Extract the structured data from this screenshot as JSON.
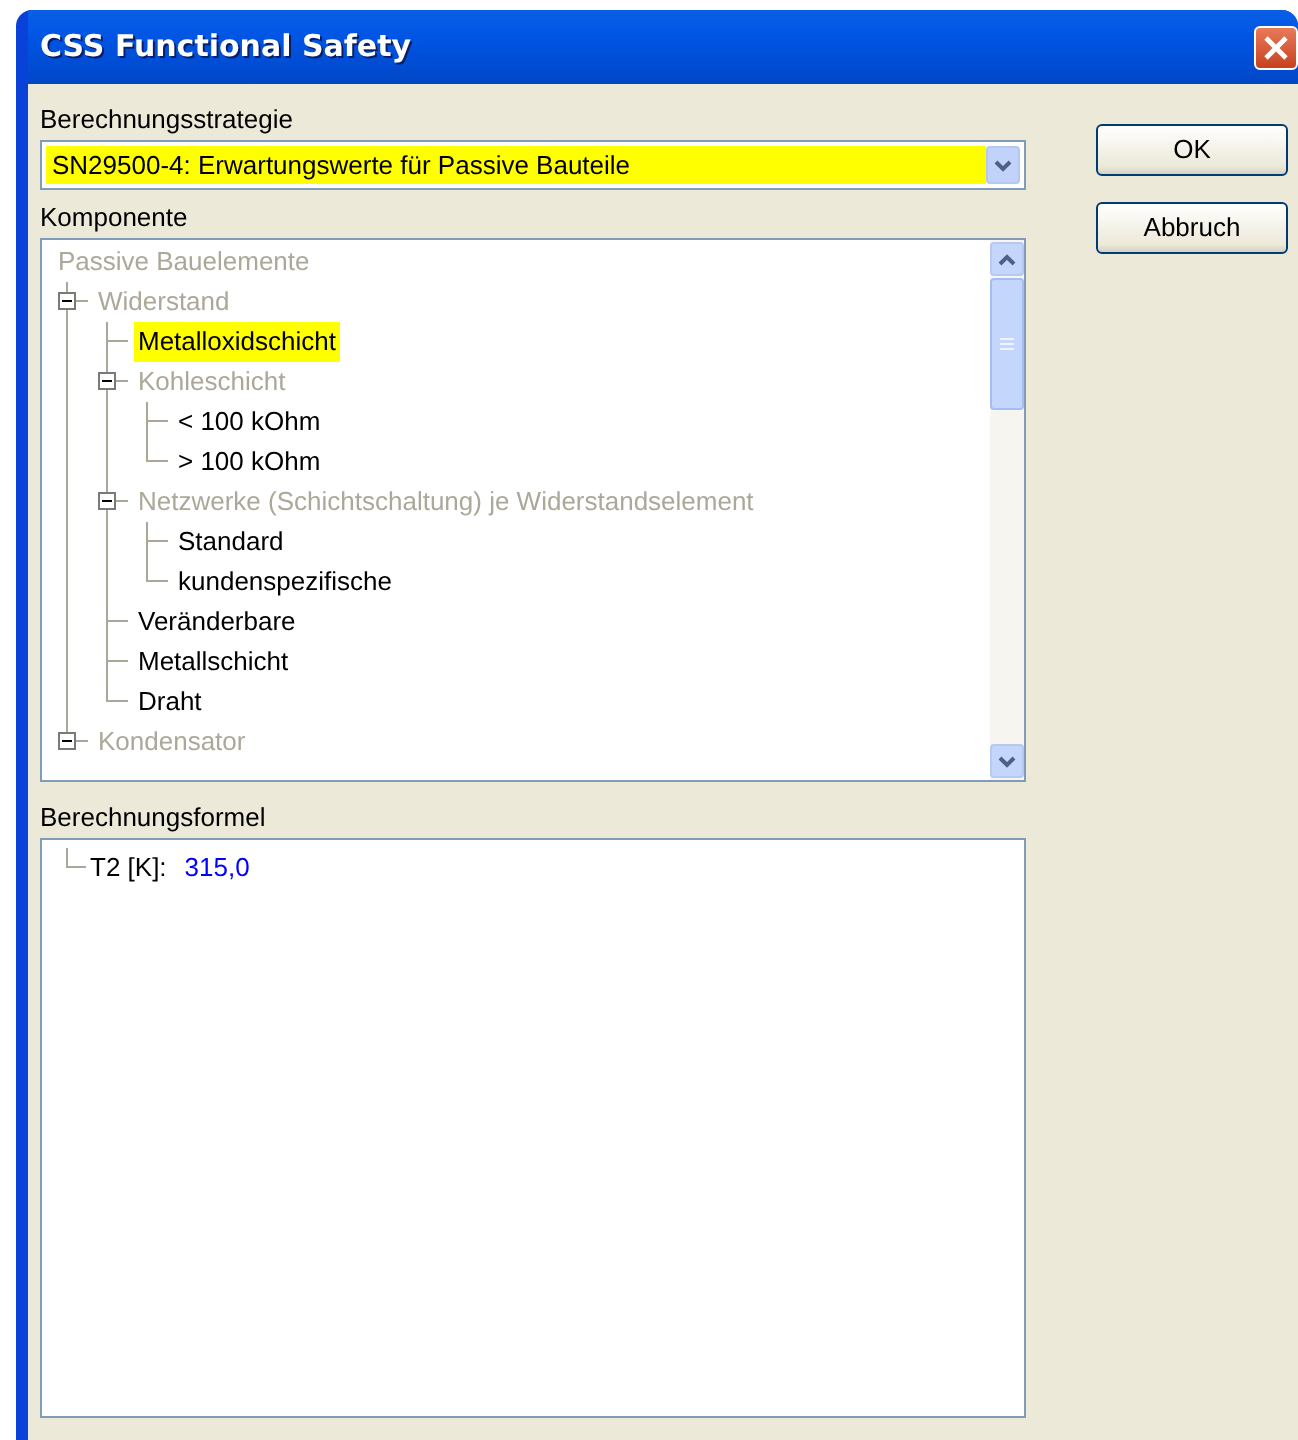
{
  "window": {
    "title": "CSS Functional Safety"
  },
  "strategy": {
    "label": "Berechnungsstrategie",
    "value": "SN29500-4: Erwartungswerte für Passive Bauteile"
  },
  "component": {
    "label": "Komponente",
    "tree": [
      {
        "label": "Passive Bauelemente",
        "disabled": true,
        "selected": false,
        "children": [
          {
            "label": "Widerstand",
            "disabled": true,
            "selected": false,
            "expanded": true,
            "children": [
              {
                "label": "Metalloxidschicht",
                "disabled": false,
                "selected": true
              },
              {
                "label": "Kohleschicht",
                "disabled": true,
                "selected": false,
                "expanded": true,
                "children": [
                  {
                    "label": "< 100 kOhm",
                    "disabled": false,
                    "selected": false
                  },
                  {
                    "label": "> 100 kOhm",
                    "disabled": false,
                    "selected": false
                  }
                ]
              },
              {
                "label": "Netzwerke (Schichtschaltung) je Widerstandselement",
                "disabled": true,
                "selected": false,
                "expanded": true,
                "children": [
                  {
                    "label": "Standard",
                    "disabled": false,
                    "selected": false
                  },
                  {
                    "label": "kundenspezifische",
                    "disabled": false,
                    "selected": false
                  }
                ]
              },
              {
                "label": "Veränderbare",
                "disabled": false,
                "selected": false
              },
              {
                "label": "Metallschicht",
                "disabled": false,
                "selected": false
              },
              {
                "label": "Draht",
                "disabled": false,
                "selected": false
              }
            ]
          },
          {
            "label": "Kondensator",
            "disabled": true,
            "selected": false,
            "expanded": true
          }
        ]
      }
    ]
  },
  "formula": {
    "label": "Berechnungsformel",
    "items": [
      {
        "name": "T2 [K]:",
        "value": "315,0"
      }
    ]
  },
  "buttons": [
    {
      "label": "OK"
    },
    {
      "label": "Abbruch"
    }
  ]
}
